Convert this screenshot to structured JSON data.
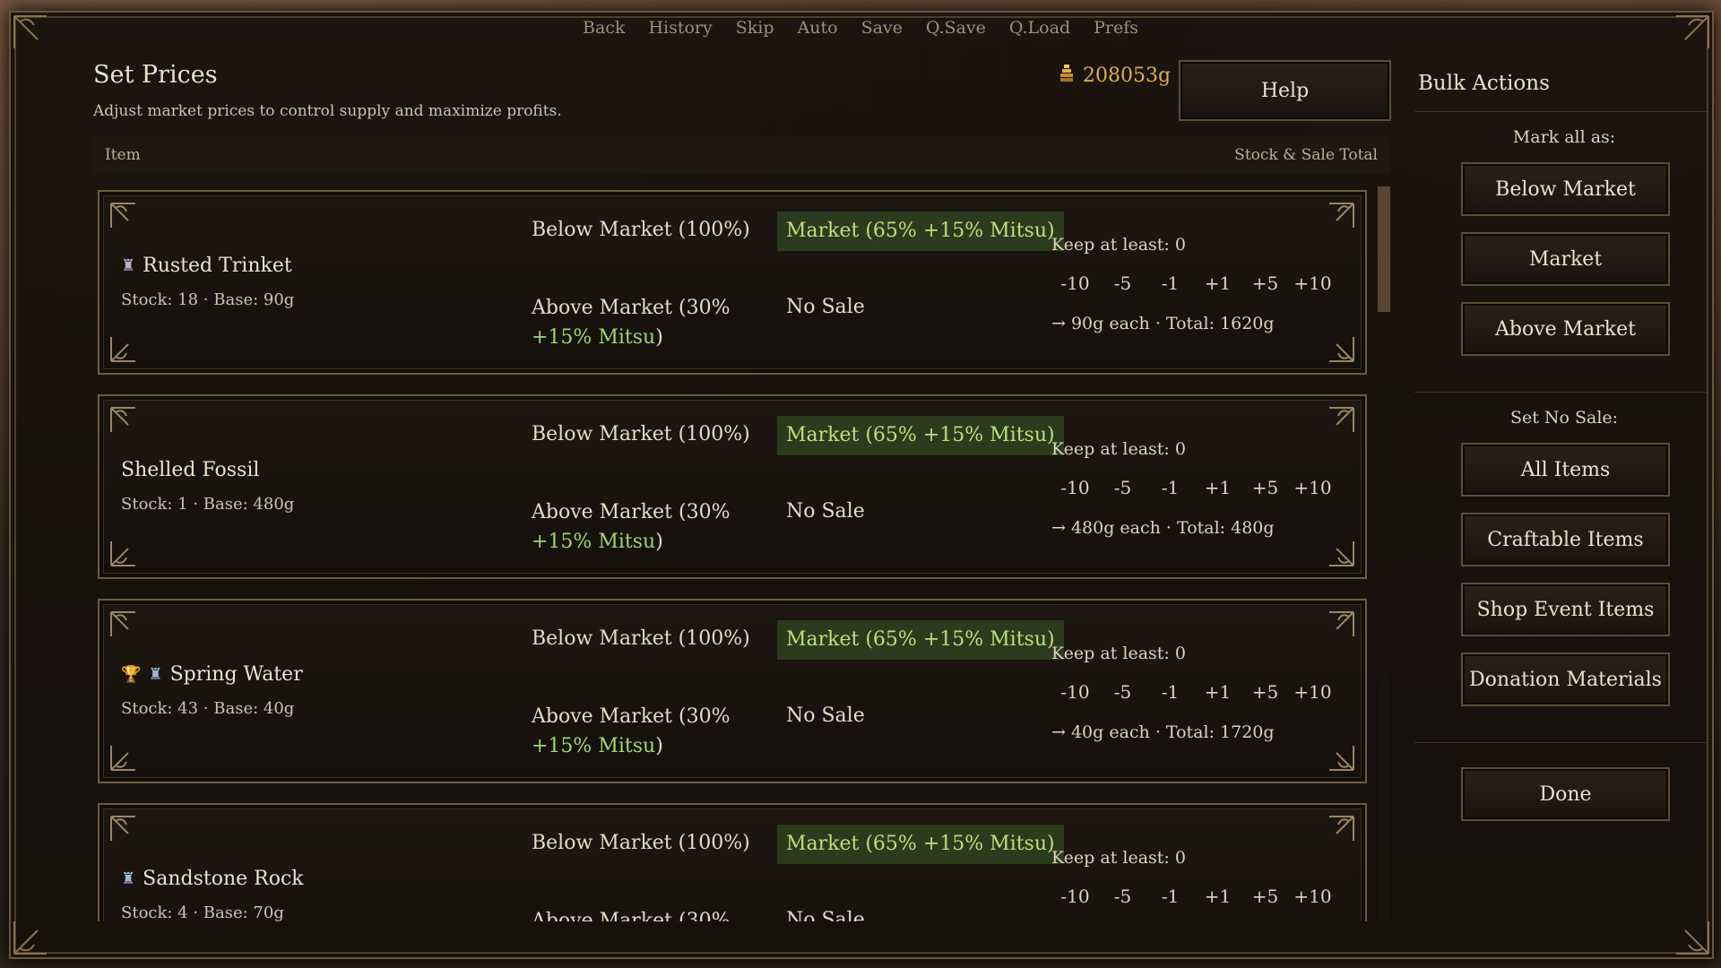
{
  "quick_menu": [
    "Back",
    "History",
    "Skip",
    "Auto",
    "Save",
    "Q.Save",
    "Q.Load",
    "Prefs"
  ],
  "header": {
    "title": "Set Prices",
    "subtitle": "Adjust market prices to control supply and maximize profits.",
    "gold": "208053g",
    "help_label": "Help"
  },
  "table": {
    "col_item": "Item",
    "col_total": "Stock & Sale Total"
  },
  "options": {
    "below": "Below Market (100%)",
    "market": "Market (65% +15% Mitsu)",
    "above_prefix": "Above Market (30% ",
    "above_mitsu": "+15% Mitsu",
    "above_suffix": ")",
    "no_sale": "No Sale"
  },
  "adjust_buttons": [
    "-10",
    "-5",
    "-1",
    "+1",
    "+5",
    "+10"
  ],
  "items": [
    {
      "name": "Rusted Trinket",
      "icons": [
        "♜"
      ],
      "stock": "Stock: 18 · Base: 90g",
      "keep": "Keep at least: 0",
      "total": "→ 90g each · Total: 1620g"
    },
    {
      "name": "Shelled Fossil",
      "icons": [],
      "stock": "Stock: 1 · Base: 480g",
      "keep": "Keep at least: 0",
      "total": "→ 480g each · Total: 480g"
    },
    {
      "name": "Spring Water",
      "icons": [
        "🏆",
        "♜"
      ],
      "stock": "Stock: 43 · Base: 40g",
      "keep": "Keep at least: 0",
      "total": "→ 40g each · Total: 1720g"
    },
    {
      "name": "Sandstone Rock",
      "icons": [
        "♜"
      ],
      "stock": "Stock: 4 · Base: 70g",
      "keep": "Keep at least: 0",
      "total": ""
    }
  ],
  "sidebar": {
    "title": "Bulk Actions",
    "mark_all_label": "Mark all as:",
    "mark_buttons": [
      "Below Market",
      "Market",
      "Above Market"
    ],
    "no_sale_label": "Set No Sale:",
    "no_sale_buttons": [
      "All Items",
      "Craftable Items",
      "Shop Event Items",
      "Donation Materials"
    ],
    "done_label": "Done"
  },
  "colors": {
    "accent_green": "#b8e27a",
    "gold": "#e0ad52",
    "frame": "#6b5638"
  }
}
